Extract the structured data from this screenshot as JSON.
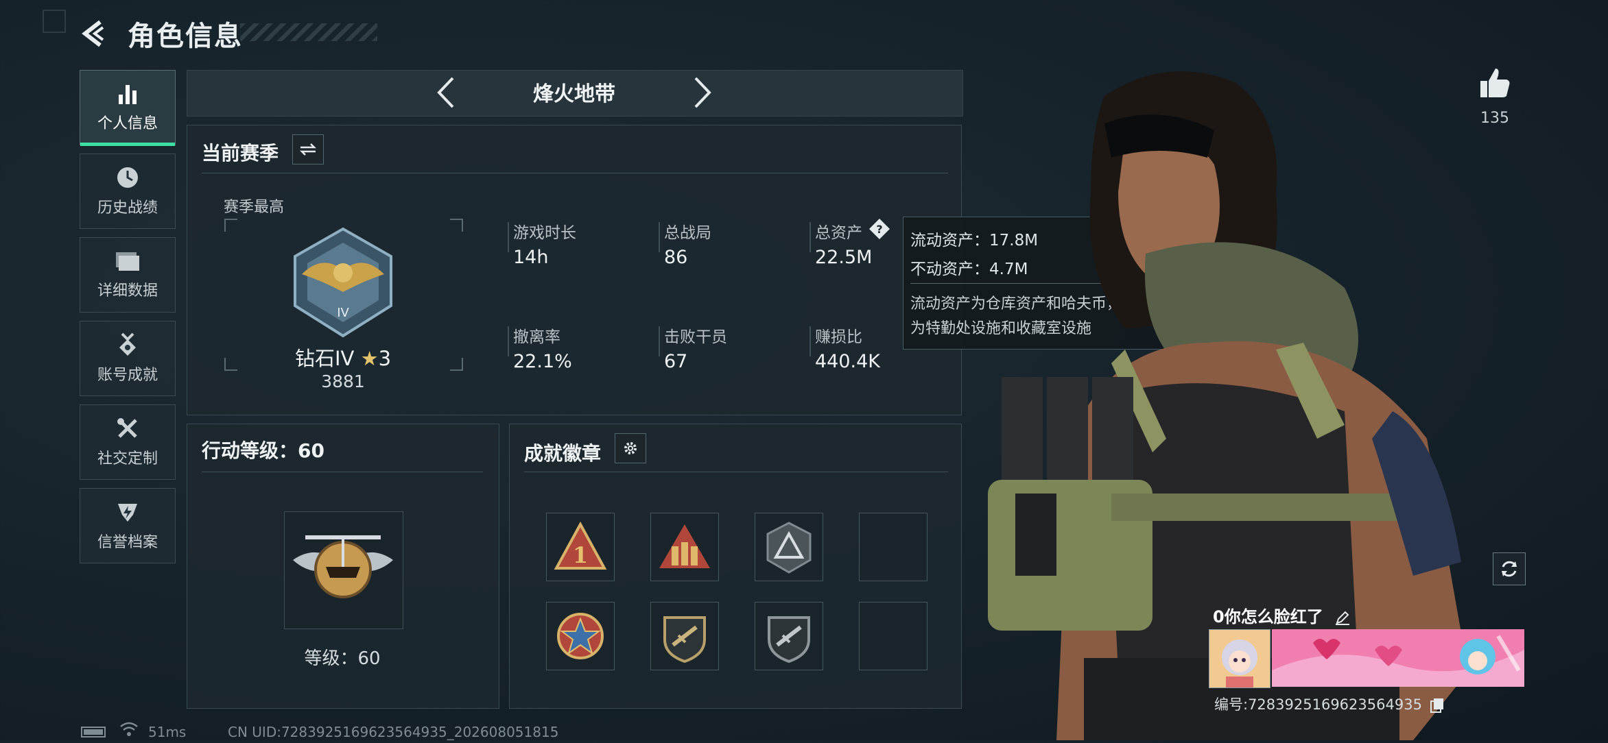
{
  "header": {
    "title": "角色信息"
  },
  "sidebar": {
    "items": [
      {
        "label": "个人信息",
        "icon": "bar-chart-icon",
        "active": true
      },
      {
        "label": "历史战绩",
        "icon": "clock-icon"
      },
      {
        "label": "详细数据",
        "icon": "folder-icon"
      },
      {
        "label": "账号成就",
        "icon": "medal-icon"
      },
      {
        "label": "社交定制",
        "icon": "tools-icon"
      },
      {
        "label": "信誉档案",
        "icon": "shield-bolt-icon"
      }
    ]
  },
  "mode": {
    "title": "烽火地带"
  },
  "season": {
    "title": "当前赛季",
    "best_label": "赛季最高",
    "rank_name": "钻石IV",
    "rank_stars": "3",
    "rank_points": "3881",
    "stats": [
      {
        "label": "游戏时长",
        "value": "14h"
      },
      {
        "label": "总战局",
        "value": "86"
      },
      {
        "label": "总资产",
        "value": "22.5M"
      },
      {
        "label": "撤离率",
        "value": "22.1%"
      },
      {
        "label": "击败干员",
        "value": "67"
      },
      {
        "label": "赚损比",
        "value": "440.4K"
      }
    ]
  },
  "tooltip": {
    "line1": "流动资产：17.8M",
    "line2": "不动资产：4.7M",
    "desc1": "流动资产为仓库资产和哈夫币，不动资产",
    "desc2": "为特勤处设施和收藏室设施"
  },
  "action_level": {
    "title": "行动等级：60",
    "level_text": "等级：60"
  },
  "achievements": {
    "title": "成就徽章",
    "badges": [
      "triangle-1-badge",
      "soldiers-badge",
      "pyramid-badge",
      "empty",
      "star-medal-badge",
      "rifle-shield-badge",
      "rifle-shield-badge-2",
      "empty"
    ]
  },
  "profile": {
    "likes": "135",
    "name": "0你怎么脸红了",
    "id_text": "编号:7283925169623564935"
  },
  "footer": {
    "ping": "51ms",
    "uid": "CN UID:7283925169623564935_202608051815"
  },
  "colors": {
    "accent_green": "#3de0a3",
    "bg": "#16222a"
  }
}
